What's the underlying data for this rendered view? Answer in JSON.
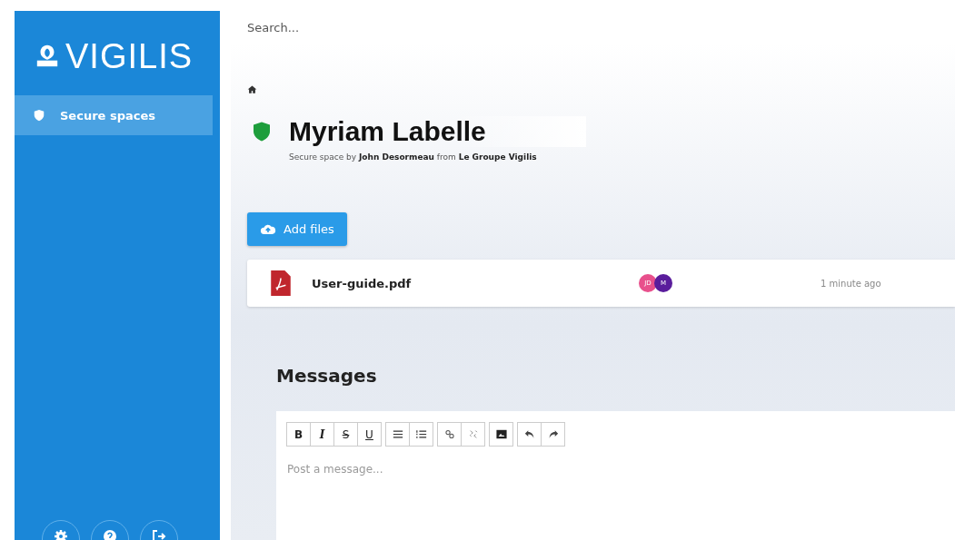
{
  "sidebar": {
    "logo": "VIGILIS",
    "items": [
      {
        "label": "Secure spaces",
        "selected": true
      }
    ],
    "footer_buttons": [
      {
        "kind": "settings"
      },
      {
        "kind": "help"
      },
      {
        "kind": "logout"
      }
    ]
  },
  "search": {
    "placeholder": "Search..."
  },
  "header": {
    "title": "Myriam Labelle",
    "subtitle": "Secure space by **John Desormeau** from **Le Groupe Vigilis**"
  },
  "add_files_button": "Add files",
  "files": [
    {
      "name": "User-guide.pdf",
      "time": "1 minute ago",
      "avatars": [
        {
          "initials": "JD",
          "color": "#e8508c"
        },
        {
          "initials": "M",
          "color": "#5a1d9c"
        }
      ]
    }
  ],
  "messages": {
    "heading": "Messages",
    "placeholder": "Post a message...",
    "toolbar": [
      [
        {
          "kind": "bold",
          "label": "B"
        },
        {
          "kind": "italic",
          "label": "I"
        },
        {
          "kind": "strike",
          "label": "S"
        },
        {
          "kind": "underline",
          "label": "U"
        }
      ],
      [
        {
          "kind": "bullet-list"
        },
        {
          "kind": "numbered-list"
        }
      ],
      [
        {
          "kind": "link"
        },
        {
          "kind": "unlink"
        }
      ],
      [
        {
          "kind": "image"
        }
      ],
      [
        {
          "kind": "undo"
        },
        {
          "kind": "redo"
        }
      ]
    ]
  }
}
